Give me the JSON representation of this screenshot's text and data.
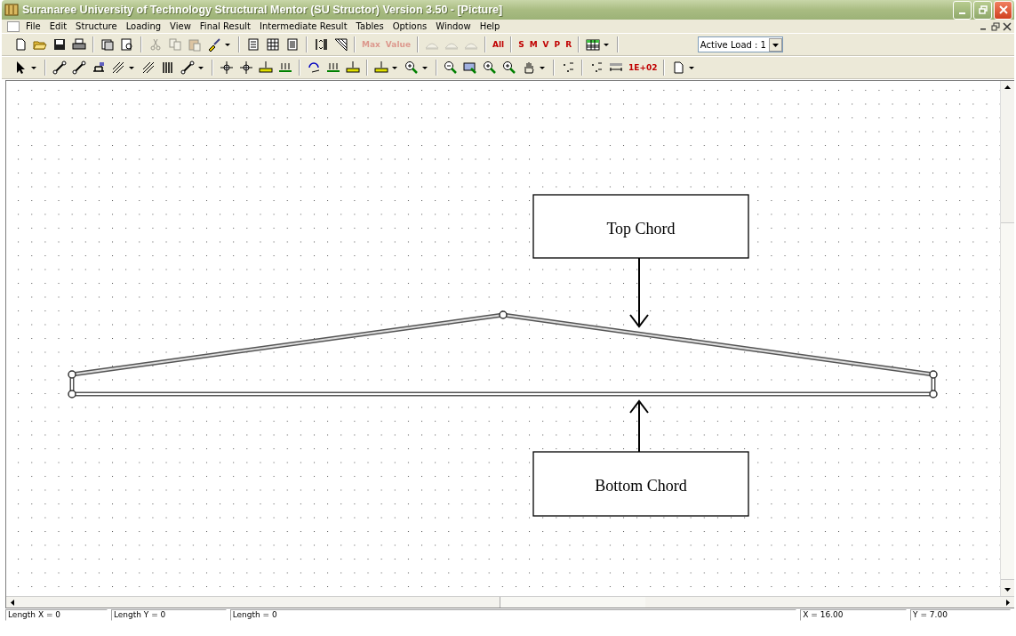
{
  "window": {
    "title": "Suranaree University of Technology Structural Mentor (SU Structor) Version 3.50 - [Picture]"
  },
  "menu": [
    "File",
    "Edit",
    "Structure",
    "Loading",
    "View",
    "Final Result",
    "Intermediate Result",
    "Tables",
    "Options",
    "Window",
    "Help"
  ],
  "toolbar_1": [
    {
      "kind": "icon",
      "disabled": false
    },
    {
      "kind": "icon",
      "disabled": false
    },
    {
      "kind": "icon",
      "disabled": false
    },
    {
      "kind": "icon",
      "disabled": false
    },
    {
      "kind": "sep"
    },
    {
      "kind": "icon",
      "disabled": false
    },
    {
      "kind": "icon",
      "disabled": false
    },
    {
      "kind": "sep"
    },
    {
      "kind": "icon",
      "disabled": true
    },
    {
      "kind": "icon",
      "disabled": true
    },
    {
      "kind": "icon",
      "disabled": true
    },
    {
      "kind": "icon",
      "disabled": false
    },
    {
      "kind": "drop"
    },
    {
      "kind": "sep"
    },
    {
      "kind": "icon",
      "disabled": false
    },
    {
      "kind": "icon",
      "disabled": false
    },
    {
      "kind": "icon",
      "disabled": false
    },
    {
      "kind": "sep"
    },
    {
      "kind": "icon",
      "disabled": false
    },
    {
      "kind": "icon",
      "disabled": false
    },
    {
      "kind": "sep"
    },
    {
      "kind": "text",
      "label": "Max",
      "disabled": true
    },
    {
      "kind": "text",
      "label": "Value",
      "disabled": true
    },
    {
      "kind": "sep"
    },
    {
      "kind": "icon",
      "disabled": true
    },
    {
      "kind": "icon",
      "disabled": true
    },
    {
      "kind": "icon",
      "disabled": true
    },
    {
      "kind": "sep"
    },
    {
      "kind": "text",
      "label": "All",
      "disabled": false
    },
    {
      "kind": "sep"
    },
    {
      "kind": "text",
      "label": "S",
      "disabled": false
    },
    {
      "kind": "text",
      "label": "M",
      "disabled": false
    },
    {
      "kind": "text",
      "label": "V",
      "disabled": false
    },
    {
      "kind": "text",
      "label": "P",
      "disabled": false
    },
    {
      "kind": "text",
      "label": "R",
      "disabled": false
    },
    {
      "kind": "sep"
    },
    {
      "kind": "icon",
      "disabled": false
    },
    {
      "kind": "drop"
    },
    {
      "kind": "sep"
    },
    {
      "kind": "combo",
      "value": "Active Load : 1"
    }
  ],
  "toolbar_2": [
    {
      "kind": "icon",
      "disabled": false
    },
    {
      "kind": "drop"
    },
    {
      "kind": "sep"
    },
    {
      "kind": "icon",
      "disabled": false
    },
    {
      "kind": "icon",
      "disabled": false
    },
    {
      "kind": "icon",
      "disabled": false
    },
    {
      "kind": "icon",
      "disabled": false
    },
    {
      "kind": "drop"
    },
    {
      "kind": "icon",
      "disabled": false
    },
    {
      "kind": "icon",
      "disabled": false
    },
    {
      "kind": "icon",
      "disabled": false
    },
    {
      "kind": "drop"
    },
    {
      "kind": "sep"
    },
    {
      "kind": "icon",
      "disabled": false
    },
    {
      "kind": "icon",
      "disabled": false
    },
    {
      "kind": "icon",
      "disabled": false
    },
    {
      "kind": "icon",
      "disabled": false
    },
    {
      "kind": "sep"
    },
    {
      "kind": "icon",
      "disabled": false
    },
    {
      "kind": "icon",
      "disabled": false
    },
    {
      "kind": "icon",
      "disabled": false
    },
    {
      "kind": "sep"
    },
    {
      "kind": "icon",
      "disabled": false
    },
    {
      "kind": "drop"
    },
    {
      "kind": "icon",
      "disabled": false
    },
    {
      "kind": "drop"
    },
    {
      "kind": "sep"
    },
    {
      "kind": "icon",
      "disabled": false
    },
    {
      "kind": "icon",
      "disabled": false
    },
    {
      "kind": "icon",
      "disabled": false
    },
    {
      "kind": "icon",
      "disabled": false
    },
    {
      "kind": "icon",
      "disabled": false
    },
    {
      "kind": "drop"
    },
    {
      "kind": "sep"
    },
    {
      "kind": "icon",
      "disabled": false
    },
    {
      "kind": "sep"
    },
    {
      "kind": "icon",
      "disabled": false
    },
    {
      "kind": "icon",
      "disabled": false
    },
    {
      "kind": "text",
      "label": "1E+02",
      "disabled": false
    },
    {
      "kind": "sep"
    },
    {
      "kind": "icon",
      "disabled": false
    },
    {
      "kind": "drop"
    }
  ],
  "canvas": {
    "callouts": [
      {
        "label": "Top Chord",
        "below_truss": false
      },
      {
        "label": "Bottom Chord",
        "below_truss": true
      }
    ]
  },
  "status_bar": [
    "Length X = 0",
    "Length Y = 0",
    "Length = 0",
    "X = 16.00",
    "Y = 7.00"
  ]
}
